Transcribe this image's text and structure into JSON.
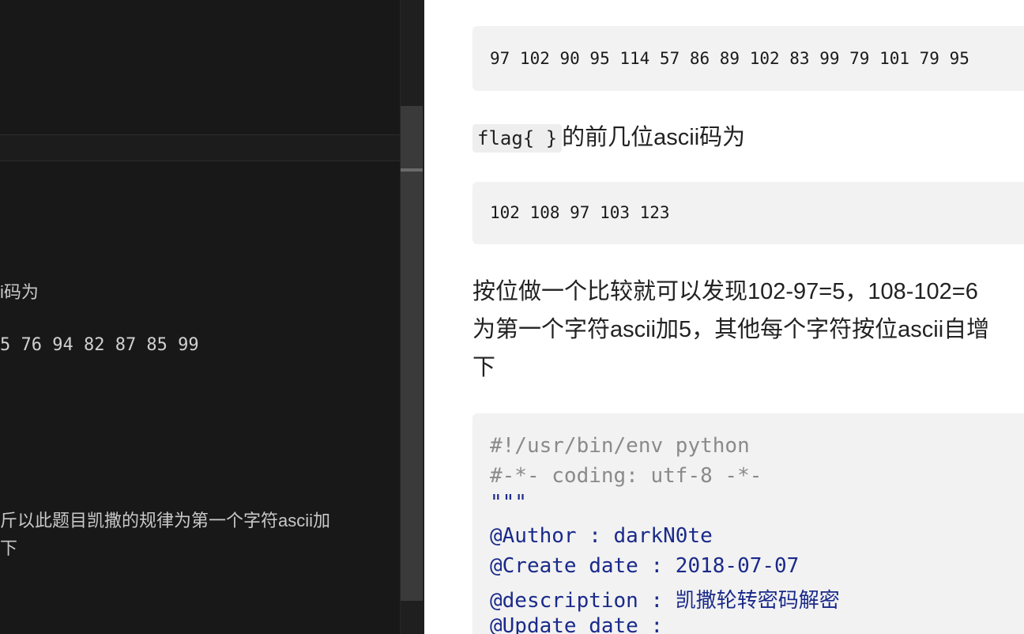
{
  "editor": {
    "line_ascii": "i码为",
    "line_numbers": "5 76 94 82 87 85 99",
    "line_para_a": "斤以此题目凯撒的规律为第一个字符ascii加",
    "line_para_b": "下"
  },
  "preview": {
    "code_numbers": "97 102 90 95 114 57 86 89 102 83 99 79 101 79 95",
    "inline_code": "flag{ }",
    "para1_text": "的前几位ascii码为",
    "code_flag_prefix": "102 108 97 103 123",
    "para2_line1": "按位做一个比较就可以发现102-97=5，108-102=6",
    "para2_line2": "为第一个字符ascii加5，其他每个字符按位ascii自增",
    "para2_line3": "下",
    "python": {
      "shebang": "#!/usr/bin/env python",
      "coding": "#-*- coding: utf-8 -*-",
      "docstart": "\"\"\"",
      "author": "@Author : darkN0te",
      "create": "@Create date : 2018-07-07",
      "description": "@description : 凯撒轮转密码解密",
      "update": "@Update date :"
    }
  }
}
